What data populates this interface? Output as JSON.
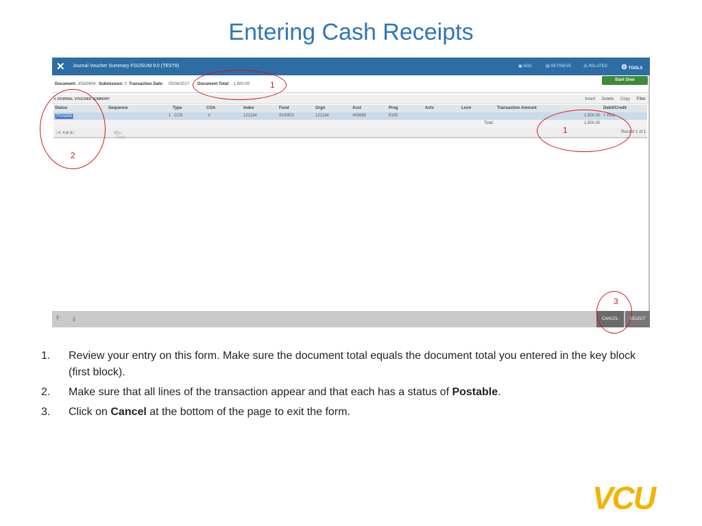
{
  "slide_title": "Entering Cash Receipts",
  "app": {
    "close_icon": "close-icon",
    "title": "Journal Voucher Summary FGIJSUM 9.0 (TEST8)",
    "toolbar": [
      "ADD",
      "RETRIEVE",
      "RELATED",
      "TOOLS"
    ],
    "key_block": {
      "document_label": "Document:",
      "document": "J0543904",
      "submission_label": "Submission:",
      "submission": "0",
      "date_label": "Transaction Date:",
      "date": "05/08/2017",
      "total_label": "Document Total:",
      "total": "1,500.00"
    },
    "start_over": "Start Over",
    "section_title": "JOURNAL VOUCHER SUMMARY",
    "section_tools": [
      "Insert",
      "Delete",
      "Copy",
      "Filter"
    ],
    "columns": [
      "Status",
      "Sequence",
      "Type",
      "COA",
      "Index",
      "Fund",
      "Orgn",
      "Acct",
      "Prog",
      "Actv",
      "Locn",
      "Transaction Amount",
      "Debit/Credit"
    ],
    "rows": [
      [
        "Postable",
        "1",
        "CCK",
        "V",
        "121134",
        "9100EG",
        "121134",
        "400689",
        "5100",
        "",
        "",
        "1,500.00",
        "+ Plus"
      ]
    ],
    "total_label": "Total:",
    "total_value": "1,500.00",
    "pager": {
      "page": "1",
      "of": "of 1",
      "per_page": "10",
      "per_page_label": "Per Page",
      "record": "Record 1 of 1"
    },
    "bottom": {
      "cancel": "CANCEL",
      "select": "SELECT"
    }
  },
  "annotations": [
    "1",
    "1",
    "2",
    "3"
  ],
  "instructions": [
    {
      "n": "1.",
      "text": "Review your entry on this form. Make sure the document total equals the document total you entered in the key block (first block)."
    },
    {
      "n": "2.",
      "pre": "Make sure that all lines of the transaction appear and that each has a status of ",
      "bold": "Postable",
      "post": "."
    },
    {
      "n": "3.",
      "pre": "Click on ",
      "bold": "Cancel",
      "post": " at the bottom of the page to exit the form."
    }
  ],
  "logo": "VCU",
  "colors": {
    "title": "#2e75b6",
    "header": "#2d6da3",
    "annotation": "#d0131a",
    "logo": "#f2b400"
  }
}
